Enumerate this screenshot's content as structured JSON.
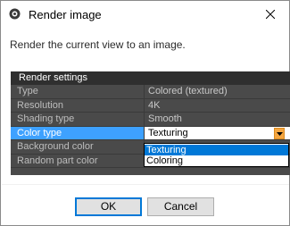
{
  "window": {
    "title": "Render image",
    "close_icon": "close-icon",
    "app_icon": "render-camera-icon"
  },
  "message": "Render the current view to an image.",
  "panel": {
    "title": "Render settings",
    "rows": [
      {
        "name": "Type",
        "value": "Colored (textured)"
      },
      {
        "name": "Resolution",
        "value": "4K"
      },
      {
        "name": "Shading type",
        "value": "Smooth"
      },
      {
        "name": "Color type",
        "value": "Texturing"
      },
      {
        "name": "Background color",
        "value": ""
      },
      {
        "name": "Random part color",
        "value": ""
      }
    ]
  },
  "dropdown": {
    "options": [
      "Texturing",
      "Coloring"
    ],
    "selected": "Texturing"
  },
  "buttons": {
    "ok": "OK",
    "cancel": "Cancel"
  },
  "colors": {
    "selection": "#3ea1ff",
    "dropdown_highlight": "#0078d7",
    "dropdown_button": "#f5a640",
    "panel_background": "#4a4a4a"
  }
}
